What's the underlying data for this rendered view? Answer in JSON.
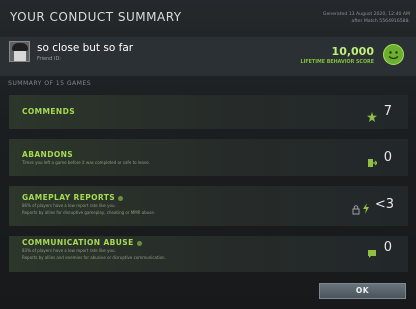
{
  "window": {
    "title": "YOUR CONDUCT SUMMARY",
    "generated": "Generated 13 August 2020, 12:40 AM",
    "after_match": "after Match 5564916588."
  },
  "user": {
    "name": "so close but so far",
    "friend_id_label": "Friend ID:",
    "score": "10,000",
    "score_label": "LIFETIME BEHAVIOR SCORE"
  },
  "summary": {
    "heading": "SUMMARY OF 15 GAMES"
  },
  "cards": [
    {
      "title": "COMMENDS",
      "lines": [],
      "value": "7",
      "icon": "commend-icon"
    },
    {
      "title": "ABANDONS",
      "lines": [
        "Times you left a game before it was completed or safe to leave."
      ],
      "value": "0",
      "icon": "abandon-icon"
    },
    {
      "title": "GAMEPLAY REPORTS",
      "lines": [
        "86% of players have a low report rate like you.",
        "Reports by allies for disruptive gameplay, cheating or MMR abuse."
      ],
      "value": "<3",
      "icon": "report-icon"
    },
    {
      "title": "COMMUNICATION ABUSE",
      "lines": [
        "83% of players have a low report rate like you.",
        "Reports by allies and enemies for abusive or disruptive communication."
      ],
      "value": "0",
      "icon": "chat-icon"
    }
  ],
  "actions": {
    "ok": "OK"
  },
  "colors": {
    "accent": "#a6db52",
    "score": "#bff07a"
  }
}
